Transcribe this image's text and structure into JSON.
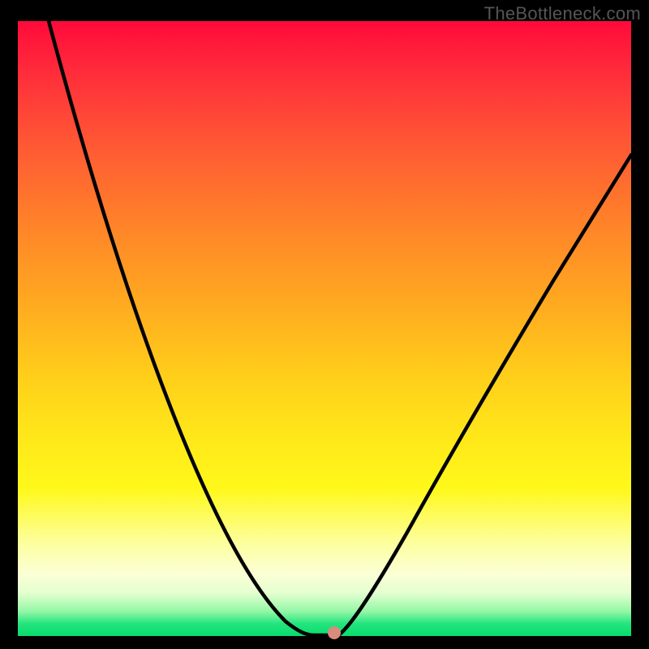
{
  "watermark": "TheBottleneck.com",
  "chart_data": {
    "type": "line",
    "title": "",
    "xlabel": "",
    "ylabel": "",
    "xlim": [
      0,
      100
    ],
    "ylim": [
      0,
      100
    ],
    "grid": false,
    "legend": false,
    "background": "red-yellow-green vertical gradient",
    "series": [
      {
        "name": "bottleneck-curve",
        "color": "#000000",
        "x": [
          5,
          10,
          15,
          20,
          25,
          30,
          35,
          40,
          43,
          45,
          47,
          49,
          50,
          52,
          55,
          60,
          65,
          70,
          75,
          80,
          85,
          90,
          95,
          100
        ],
        "y": [
          100,
          88,
          76,
          65,
          54,
          43,
          33,
          22,
          13,
          7,
          2,
          0,
          0,
          0,
          3,
          11,
          20,
          29,
          37,
          44,
          51,
          57,
          62,
          67
        ]
      }
    ],
    "marker": {
      "x": 51.5,
      "y": 0,
      "color": "#d98b7d"
    },
    "note": "Values estimated from pixel positions; chart has no visible axis ticks or labels."
  }
}
